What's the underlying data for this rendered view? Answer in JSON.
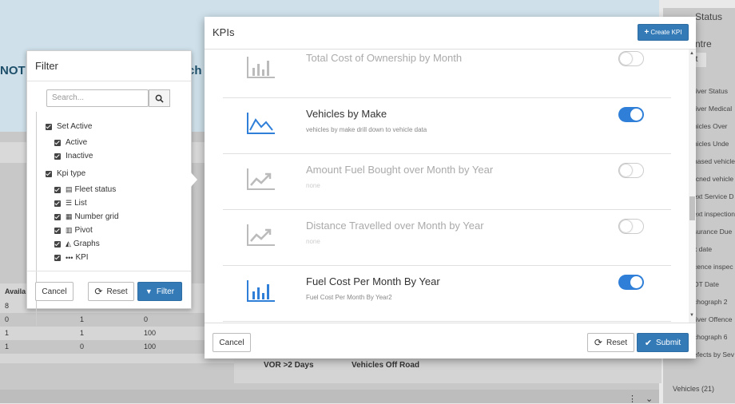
{
  "background": {
    "banner_left": "NOT",
    "banner_mid": "ch",
    "right_panel_title": "Status",
    "right_panel_subtitle": "ntre",
    "right_tab": "t",
    "right_items": [
      "river Status",
      "river Medical",
      "hicles Over",
      "hicles Unde",
      "hased vehicle",
      "rcned vehicle",
      "ext Service D",
      "ext inspection",
      "surance Due",
      "x date",
      "cence inspec",
      "OT Date",
      "chograph 2",
      "river Offence",
      "chograph 6",
      "efects by Sev"
    ],
    "right_footer": "Vehicles (21)",
    "table_header": "Availa",
    "table_rows": [
      [
        "8",
        "",
        ""
      ],
      [
        "0",
        "1",
        "0"
      ],
      [
        "1",
        "1",
        "100"
      ],
      [
        "1",
        "0",
        "100"
      ]
    ],
    "vor_label": "VOR >2 Days",
    "vehicles_off_road": "Vehicles Off Road",
    "dots": "⋮ ⌄"
  },
  "filter": {
    "title": "Filter",
    "search_placeholder": "Search...",
    "search_icon": "search-icon",
    "tree": [
      {
        "label": "Set Active",
        "level": 0
      },
      {
        "label": "Active",
        "level": 1
      },
      {
        "label": "Inactive",
        "level": 1
      },
      {
        "label": "Kpi type",
        "level": 0
      },
      {
        "label": "Fleet status",
        "level": 1,
        "icon": "list-alt-icon"
      },
      {
        "label": "List",
        "level": 1,
        "icon": "list-icon"
      },
      {
        "label": "Number grid",
        "level": 1,
        "icon": "grid-icon"
      },
      {
        "label": "Pivot",
        "level": 1,
        "icon": "table-icon"
      },
      {
        "label": "Graphs",
        "level": 1,
        "icon": "area-chart-icon"
      },
      {
        "label": "KPI",
        "level": 1,
        "icon": "ellipsis-icon"
      }
    ],
    "cancel_label": "Cancel",
    "reset_label": "Reset",
    "filter_label": "Filter"
  },
  "kpis": {
    "title": "KPIs",
    "create_label": "Create KPI",
    "items": [
      {
        "name": "Total Cost of Ownership by Month",
        "desc": "",
        "enabled": false,
        "icon": "bar-chart-icon"
      },
      {
        "name": "Vehicles by Make",
        "desc": "vehicles by make drill down to vehicle data",
        "enabled": true,
        "icon": "area-chart-icon"
      },
      {
        "name": "Amount Fuel Bought over Month by Year",
        "desc": "none",
        "enabled": false,
        "icon": "line-chart-icon"
      },
      {
        "name": "Distance Travelled over Month by Year",
        "desc": "none",
        "enabled": false,
        "icon": "line-chart-icon"
      },
      {
        "name": "Fuel Cost Per Month By Year",
        "desc": "Fuel Cost Per Month By Year2",
        "enabled": true,
        "icon": "bar-chart-icon"
      }
    ],
    "cancel_label": "Cancel",
    "reset_label": "Reset",
    "submit_label": "Submit"
  },
  "colors": {
    "primary": "#337ab7",
    "toggle_on": "#2f7fd9",
    "icon_active": "#2f7fd9",
    "icon_dim": "#bbbbbb"
  }
}
